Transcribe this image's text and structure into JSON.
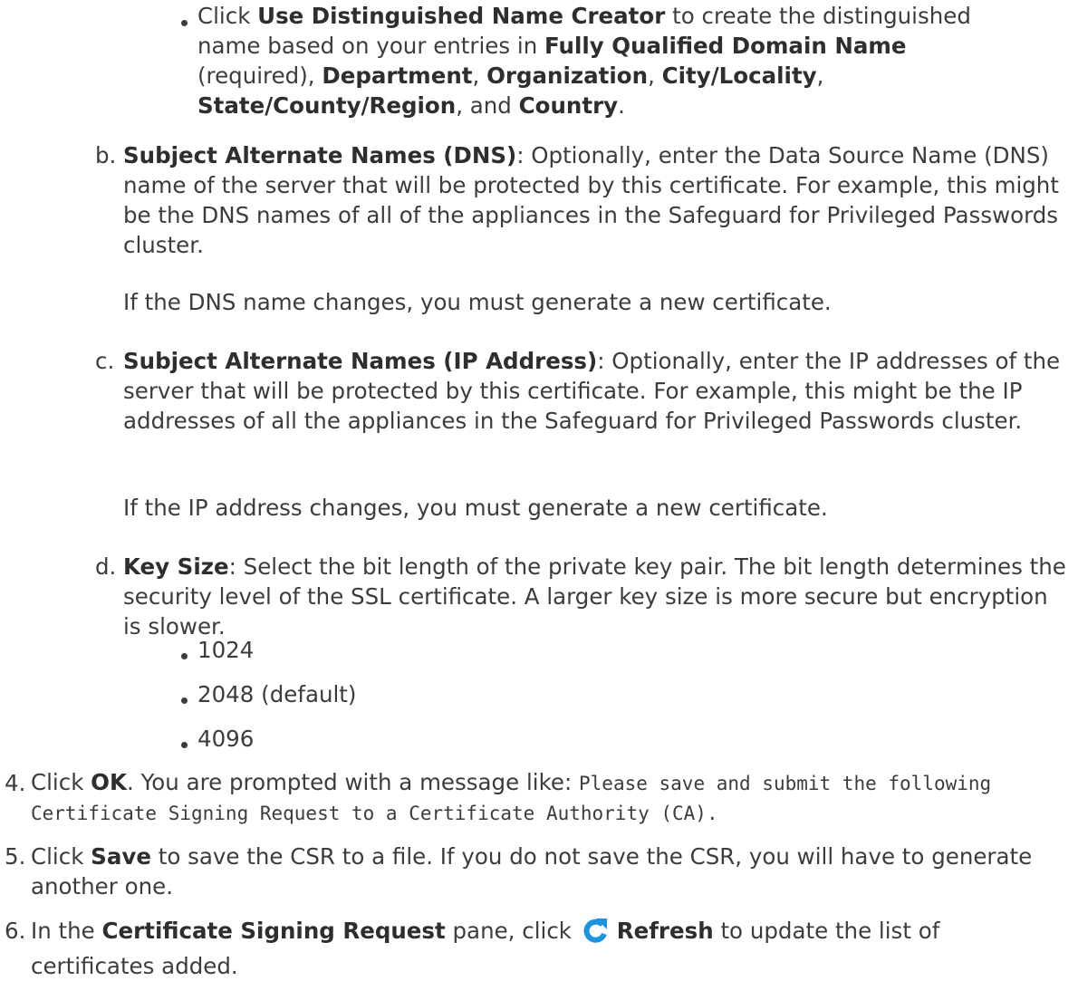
{
  "bullet_dn": {
    "t1": "Click ",
    "b1": "Use Distinguished Name Creator",
    "t2": " to create the distinguished name based on your entries in ",
    "b2": "Fully Qualified Domain Name",
    "t3": " (required), ",
    "b3": "Department",
    "t4": ", ",
    "b4": "Organization",
    "t5": ", ",
    "b5": "City/Locality",
    "t6": ", ",
    "b6": "State/County/Region",
    "t7": ", and ",
    "b7": "Country",
    "t8": "."
  },
  "item_b": {
    "marker": "b.",
    "label": "Subject Alternate Names (DNS)",
    "text": ": Optionally, enter the Data Source Name (DNS) name of the server that will be protected by this certificate. For example, this might be the DNS names of all of the appliances in the Safeguard for Privileged Passwords cluster.",
    "note": "If the DNS name changes, you must generate a new certificate."
  },
  "item_c": {
    "marker": "c.",
    "label": "Subject Alternate Names (IP Address)",
    "text": ": Optionally, enter the IP addresses of the server that will be protected by this certificate. For example, this might be the IP addresses of all the appliances in the Safeguard for Privileged Passwords cluster.",
    "note": "If the IP address changes, you must generate a new certificate."
  },
  "item_d": {
    "marker": "d.",
    "label": "Key Size",
    "text": ": Select the bit length of the private key pair. The bit length determines the security level of the SSL certificate. A larger key size is more secure but encryption is slower.",
    "options": [
      "1024",
      "2048 (default)",
      "4096"
    ]
  },
  "step_4": {
    "marker": "4.",
    "t1": "Click ",
    "b1": "OK",
    "t2": ". You are prompted with a message like: ",
    "code": "Please save and submit the following Certificate Signing Request to a Certificate Authority (CA)."
  },
  "step_5": {
    "marker": "5.",
    "t1": "Click ",
    "b1": "Save",
    "t2": " to save the CSR to a file. If you do not save the CSR, you will have to generate another one."
  },
  "step_6": {
    "marker": "6.",
    "t1": "In the ",
    "b1": "Certificate Signing Request",
    "t2": " pane, click ",
    "icon": "refresh-icon",
    "b2": "Refresh",
    "t3": " to update the list of certificates added."
  },
  "colors": {
    "text": "#3c3c3c",
    "icon": "#1c94e0"
  }
}
